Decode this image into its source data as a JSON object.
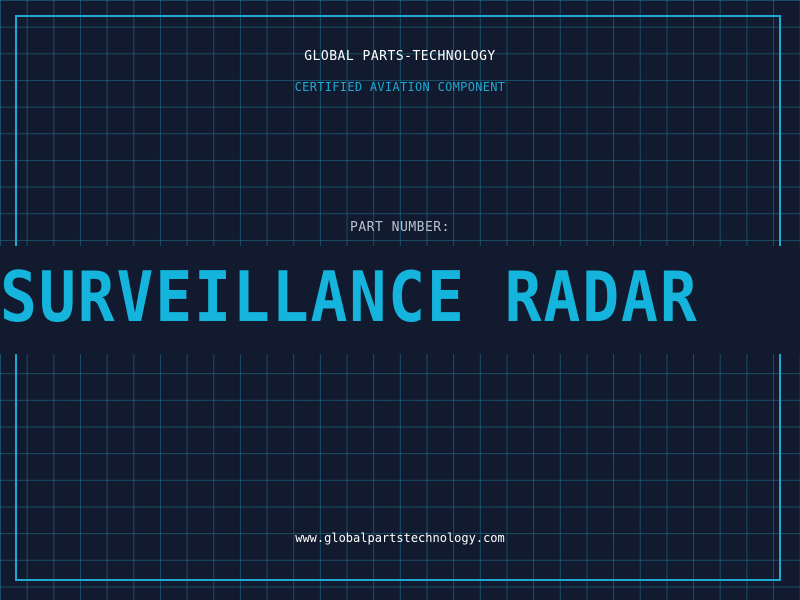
{
  "header": {
    "brand": "GLOBAL PARTS-TECHNOLOGY",
    "tagline": "CERTIFIED AVIATION COMPONENT"
  },
  "main": {
    "part_label": "PART NUMBER:",
    "part_value": "SURVEILLANCE RADAR"
  },
  "footer": {
    "website": "www.globalpartstechnology.com"
  },
  "colors": {
    "background": "#111a2e",
    "grid": "#22789a",
    "accent": "#14b4dc",
    "frame": "#1fa8d0"
  }
}
